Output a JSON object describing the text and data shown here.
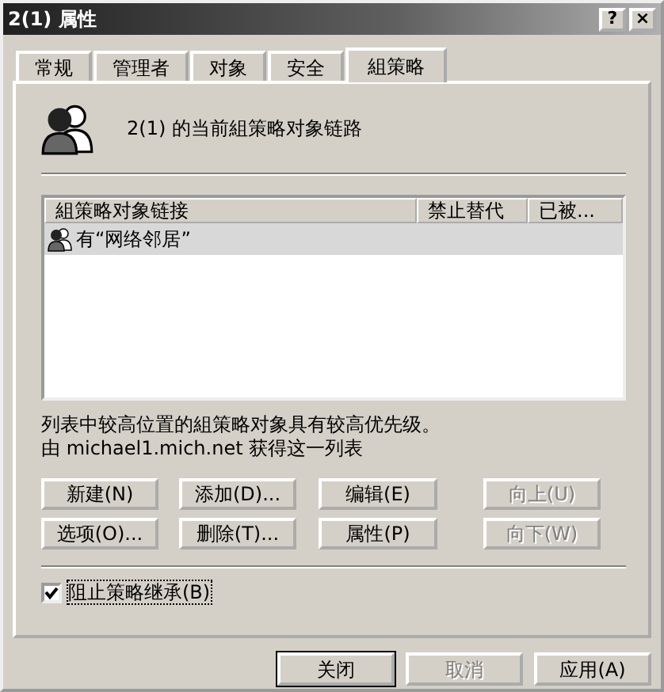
{
  "window": {
    "title": "2(1) 属性",
    "title_buttons": [
      "?",
      "×"
    ]
  },
  "tabs": [
    {
      "label": "常规",
      "selected": false
    },
    {
      "label": "管理者",
      "selected": false
    },
    {
      "label": "对象",
      "selected": false
    },
    {
      "label": "安全",
      "selected": false
    },
    {
      "label": "組策略",
      "selected": true
    }
  ],
  "heading": "2(1) 的当前組策略对象链路",
  "list": {
    "columns": [
      "組策略对象链接",
      "禁止替代",
      "已被..."
    ],
    "rows": [
      {
        "cells": [
          "有“网络邻居”"
        ],
        "selected": true
      }
    ]
  },
  "notes": [
    "列表中较高位置的組策略对象具有较高优先级。",
    "由 michael1.mich.net 获得这一列表"
  ],
  "buttons": [
    {
      "label": "新建(N)",
      "disabled": false
    },
    {
      "label": "添加(D)...",
      "disabled": false
    },
    {
      "label": "编辑(E)",
      "disabled": false
    },
    {
      "label": "向上(U)",
      "disabled": true
    },
    {
      "label": "选项(O)...",
      "disabled": false
    },
    {
      "label": "删除(T)...",
      "disabled": false
    },
    {
      "label": "属性(P)",
      "disabled": false
    },
    {
      "label": "向下(W)",
      "disabled": true
    }
  ],
  "checkbox": {
    "label": "阻止策略继承(B)",
    "checked": true
  },
  "footer_buttons": [
    {
      "label": "关闭",
      "disabled": false,
      "default": true
    },
    {
      "label": "取消",
      "disabled": true,
      "default": false
    },
    {
      "label": "应用(A)",
      "disabled": false,
      "default": false
    }
  ]
}
